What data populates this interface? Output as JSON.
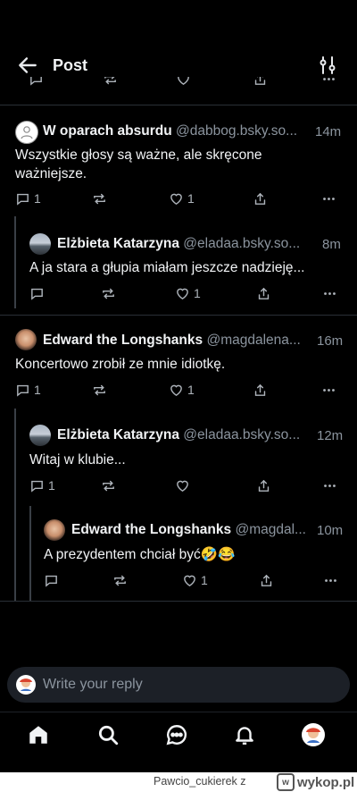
{
  "header": {
    "title": "Post"
  },
  "posts": [
    {
      "name": "W oparach absurdu",
      "handle": "@dabbog.bsky.so...",
      "time": "14m",
      "text": "Wszystkie głosy są ważne, ale skręcone ważniejsze.",
      "replies": "1",
      "likes": "1"
    },
    {
      "name": "Elżbieta Katarzyna",
      "handle": "@eladaa.bsky.so...",
      "time": "8m",
      "text": "A ja stara a głupia miałam jeszcze nadzieję...",
      "replies": "",
      "likes": "1"
    },
    {
      "name": "Edward the Longshanks",
      "handle": "@magdalena...",
      "time": "16m",
      "text": "Koncertowo zrobił ze mnie idiotkę.",
      "replies": "1",
      "likes": "1"
    },
    {
      "name": "Elżbieta Katarzyna",
      "handle": "@eladaa.bsky.so...",
      "time": "12m",
      "text": "Witaj w klubie...",
      "replies": "1",
      "likes": ""
    },
    {
      "name": "Edward the Longshanks",
      "handle": "@magdal...",
      "time": "10m",
      "text": "A prezydentem chciał być🤣😂",
      "replies": "",
      "likes": "1"
    }
  ],
  "composer": {
    "placeholder": "Write your reply"
  },
  "tabs": [
    "home-icon",
    "search-icon",
    "chat-icon",
    "bell-icon",
    "profile-avatar"
  ],
  "watermark": {
    "user": "Pawcio_cukierek",
    "sep": "z",
    "site": "wykop.pl"
  }
}
